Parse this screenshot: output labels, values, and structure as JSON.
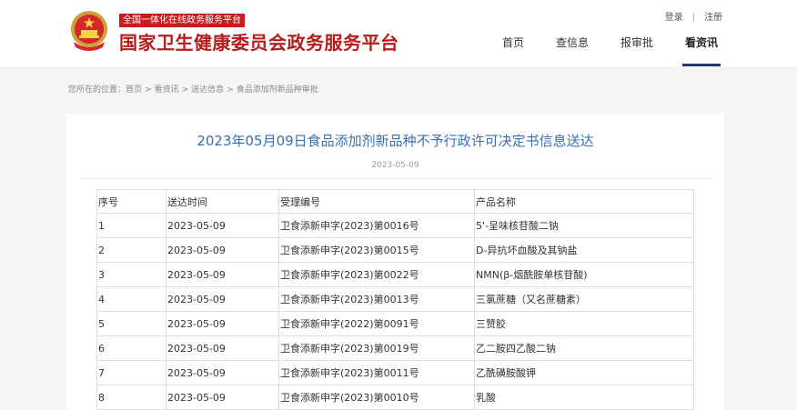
{
  "header": {
    "tagline": "全国一体化在线政务服务平台",
    "site_title": "国家卫生健康委员会政务服务平台",
    "login": "登录",
    "separator": "|",
    "register": "注册",
    "nav": [
      "首页",
      "查信息",
      "报审批",
      "看资讯"
    ],
    "active_nav": "看资讯"
  },
  "breadcrumb": {
    "prefix": "您所在的位置：",
    "items": [
      "首页",
      "看资讯",
      "送达信息",
      "食品添加剂新品种审批"
    ],
    "separator": ">"
  },
  "article": {
    "title": "2023年05月09日食品添加剂新品种不予行政许可决定书信息送达",
    "date": "2023-05-09"
  },
  "table": {
    "headers": [
      "序号",
      "送达时间",
      "受理编号",
      "产品名称"
    ],
    "rows": [
      [
        "1",
        "2023-05-09",
        "卫食添新申字(2023)第0016号",
        "5'-呈味核苷酸二钠"
      ],
      [
        "2",
        "2023-05-09",
        "卫食添新申字(2023)第0015号",
        "D-异抗坏血酸及其钠盐"
      ],
      [
        "3",
        "2023-05-09",
        "卫食添新申字(2023)第0022号",
        "NMN(β-烟酰胺单核苷酸)"
      ],
      [
        "4",
        "2023-05-09",
        "卫食添新申字(2023)第0013号",
        "三氯蔗糖（又名蔗糖素）"
      ],
      [
        "5",
        "2023-05-09",
        "卫食添新申字(2022)第0091号",
        "三赞胶"
      ],
      [
        "6",
        "2023-05-09",
        "卫食添新申字(2023)第0019号",
        "乙二胺四乙酸二钠"
      ],
      [
        "7",
        "2023-05-09",
        "卫食添新申字(2023)第0011号",
        "乙酰磺胺酸钾"
      ],
      [
        "8",
        "2023-05-09",
        "卫食添新申字(2023)第0010号",
        "乳酸"
      ]
    ]
  },
  "colors": {
    "brand_red": "#b71c1c",
    "title_blue": "#3a6fb0",
    "nav_underline": "#1e3a6e"
  }
}
